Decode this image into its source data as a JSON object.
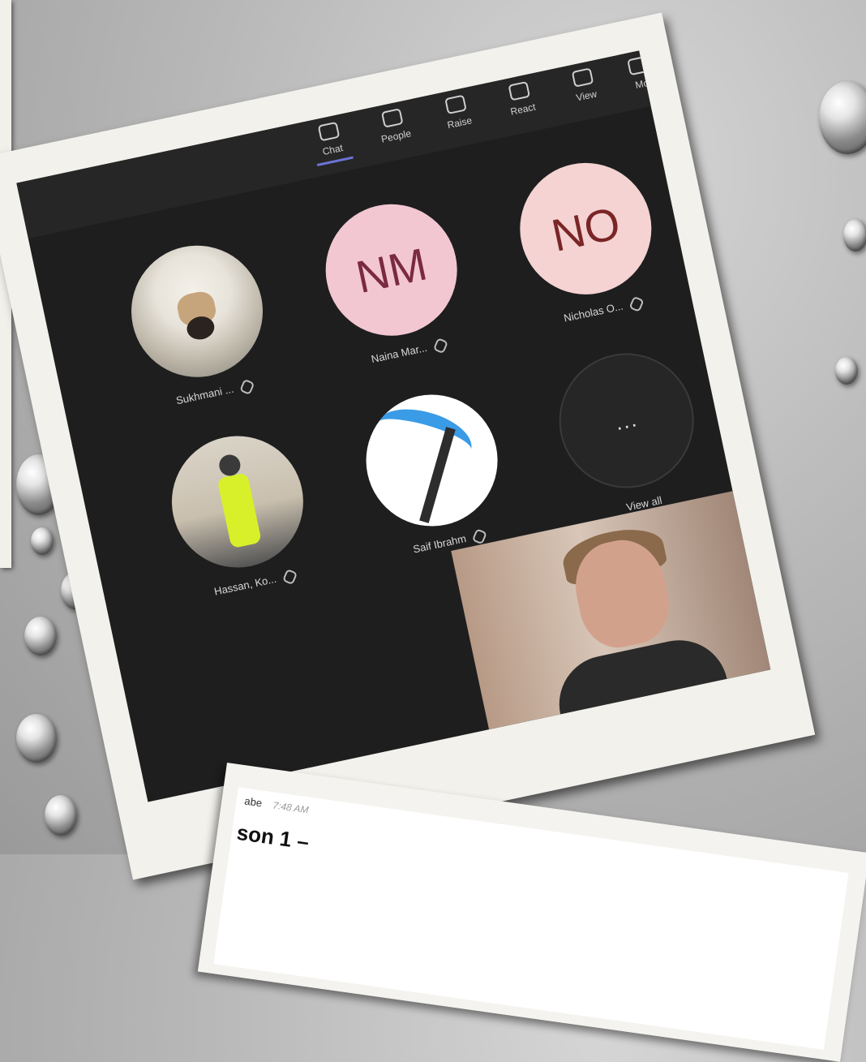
{
  "toolbar": {
    "items": [
      {
        "label": "Chat",
        "active": true
      },
      {
        "label": "People"
      },
      {
        "label": "Raise"
      },
      {
        "label": "React"
      },
      {
        "label": "View"
      },
      {
        "label": "Mo"
      }
    ]
  },
  "participants": [
    {
      "name": "Sukhmani ...",
      "avatar": "dog-photo"
    },
    {
      "name": "Naina Mar...",
      "initials": "NM",
      "color": "#f2c7d2"
    },
    {
      "name": "Nicholas O...",
      "initials": "NO",
      "color": "#f4d3d2"
    },
    {
      "name": "Hassan, Ko...",
      "avatar": "person-photo"
    },
    {
      "name": "Saif Ibrahm",
      "avatar": "pickaxe-image"
    }
  ],
  "view_all": {
    "dots": "...",
    "label": "View all"
  },
  "chat_preview": {
    "sender": "abe",
    "time": "7:48 AM",
    "text": "son 1 –"
  },
  "colors": {
    "accent": "#6b73d6",
    "screen_bg": "#1e1e1f",
    "frame": "#f2f1ec"
  }
}
